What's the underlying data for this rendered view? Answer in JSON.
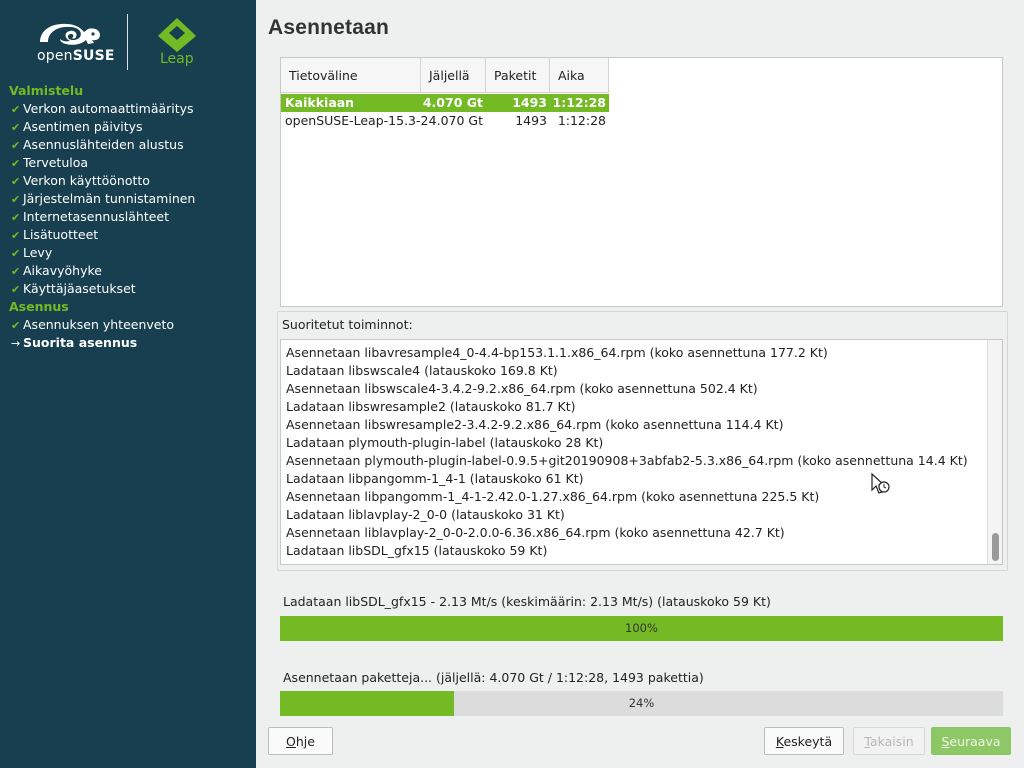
{
  "branding": {
    "open": "open",
    "suse": "SUSE",
    "leap": "Leap"
  },
  "sidebar": {
    "sections": [
      {
        "title": "Valmistelu",
        "steps": [
          {
            "label": "Verkon automaattimääritys",
            "mark": "✔"
          },
          {
            "label": "Asentimen päivitys",
            "mark": "✔"
          },
          {
            "label": "Asennuslähteiden alustus",
            "mark": "✔"
          },
          {
            "label": "Tervetuloa",
            "mark": "✔"
          },
          {
            "label": "Verkon käyttöönotto",
            "mark": "✔"
          },
          {
            "label": "Järjestelmän tunnistaminen",
            "mark": "✔"
          },
          {
            "label": "Internetasennuslähteet",
            "mark": "✔"
          },
          {
            "label": "Lisätuotteet",
            "mark": "✔"
          },
          {
            "label": "Levy",
            "mark": "✔"
          },
          {
            "label": "Aikavyöhyke",
            "mark": "✔"
          },
          {
            "label": "Käyttäjäasetukset",
            "mark": "✔"
          }
        ]
      },
      {
        "title": "Asennus",
        "steps": [
          {
            "label": "Asennuksen yhteenveto",
            "mark": "✔"
          },
          {
            "label": "Suorita asennus",
            "mark": "→",
            "current": true
          }
        ]
      }
    ]
  },
  "title": "Asennetaan",
  "media_table": {
    "headers": [
      "Tietoväline",
      "Jäljellä",
      "Paketit",
      "Aika"
    ],
    "rows": [
      {
        "name": "Kaikkiaan",
        "remaining": "4.070 Gt",
        "packages": "1493",
        "time": "1:12:28",
        "selected": true
      },
      {
        "name": "openSUSE-Leap-15.3-2",
        "remaining": "4.070 Gt",
        "packages": "1493",
        "time": "1:12:28"
      }
    ]
  },
  "log": {
    "label": "Suoritetut toiminnot:",
    "lines": [
      "Asennetaan libavresample4_0-4.4-bp153.1.1.x86_64.rpm (koko asennettuna 177.2 Kt)",
      "Ladataan libswscale4 (latauskoko 169.8 Kt)",
      "Asennetaan libswscale4-3.4.2-9.2.x86_64.rpm (koko asennettuna 502.4 Kt)",
      "Ladataan libswresample2 (latauskoko 81.7 Kt)",
      "Asennetaan libswresample2-3.4.2-9.2.x86_64.rpm (koko asennettuna 114.4 Kt)",
      "Ladataan plymouth-plugin-label (latauskoko 28 Kt)",
      "Asennetaan plymouth-plugin-label-0.9.5+git20190908+3abfab2-5.3.x86_64.rpm (koko asennettuna 14.4 Kt)",
      "Ladataan libpangomm-1_4-1 (latauskoko 61 Kt)",
      "Asennetaan libpangomm-1_4-1-2.42.0-1.27.x86_64.rpm (koko asennettuna 225.5 Kt)",
      "Ladataan liblavplay-2_0-0 (latauskoko 31 Kt)",
      "Asennetaan liblavplay-2_0-0-2.0.0-6.36.x86_64.rpm (koko asennettuna 42.7 Kt)",
      "Ladataan libSDL_gfx15 (latauskoko 59 Kt)"
    ]
  },
  "download": {
    "label": "Ladataan libSDL_gfx15 - 2.13 Mt/s (keskimäärin: 2.13 Mt/s) (latauskoko 59 Kt)",
    "progress_text": "100%",
    "progress": 1.0
  },
  "install": {
    "label": "Asennetaan paketteja... (jäljellä: 4.070 Gt / 1:12:28, 1493 pakettia)",
    "progress_text": "24%",
    "progress": 0.24
  },
  "buttons": {
    "help": {
      "mnemonic": "O",
      "rest": "hje"
    },
    "abort": {
      "mnemonic": "K",
      "rest": "eskeytä"
    },
    "back": {
      "mnemonic": "T",
      "rest": "akaisin"
    },
    "next": {
      "mnemonic": "S",
      "rest": "euraava"
    }
  },
  "colors": {
    "sidebar": "#173f4f",
    "accent": "#73ba25",
    "background": "#eef0ef"
  }
}
